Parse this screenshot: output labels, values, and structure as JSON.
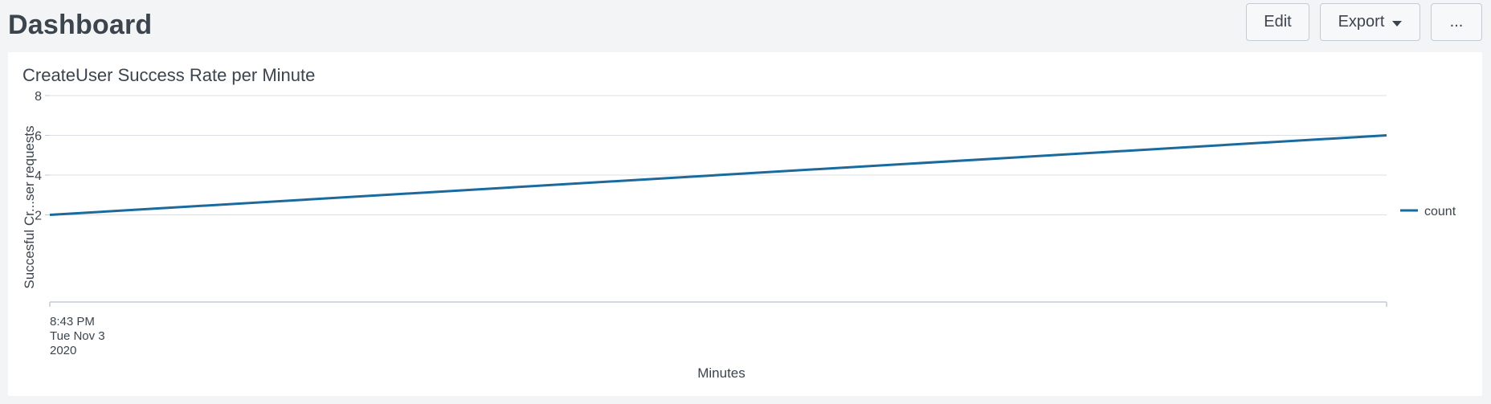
{
  "header": {
    "title": "Dashboard",
    "edit_label": "Edit",
    "export_label": "Export",
    "more_label": "..."
  },
  "panel": {
    "title": "CreateUser Success Rate per Minute"
  },
  "colors": {
    "series": "#1a6a9e"
  },
  "chart_data": {
    "type": "line",
    "title": "CreateUser Success Rate per Minute",
    "xlabel": "Minutes",
    "ylabel": "Succesful Cr...ser requests",
    "x_tick_labels": [
      [
        "8:43 PM",
        "Tue Nov 3",
        "2020"
      ]
    ],
    "yticks": [
      2,
      4,
      6,
      8
    ],
    "ylim": [
      0,
      8
    ],
    "grid": true,
    "legend_position": "right",
    "series": [
      {
        "name": "count",
        "values": [
          2,
          6
        ]
      }
    ]
  }
}
